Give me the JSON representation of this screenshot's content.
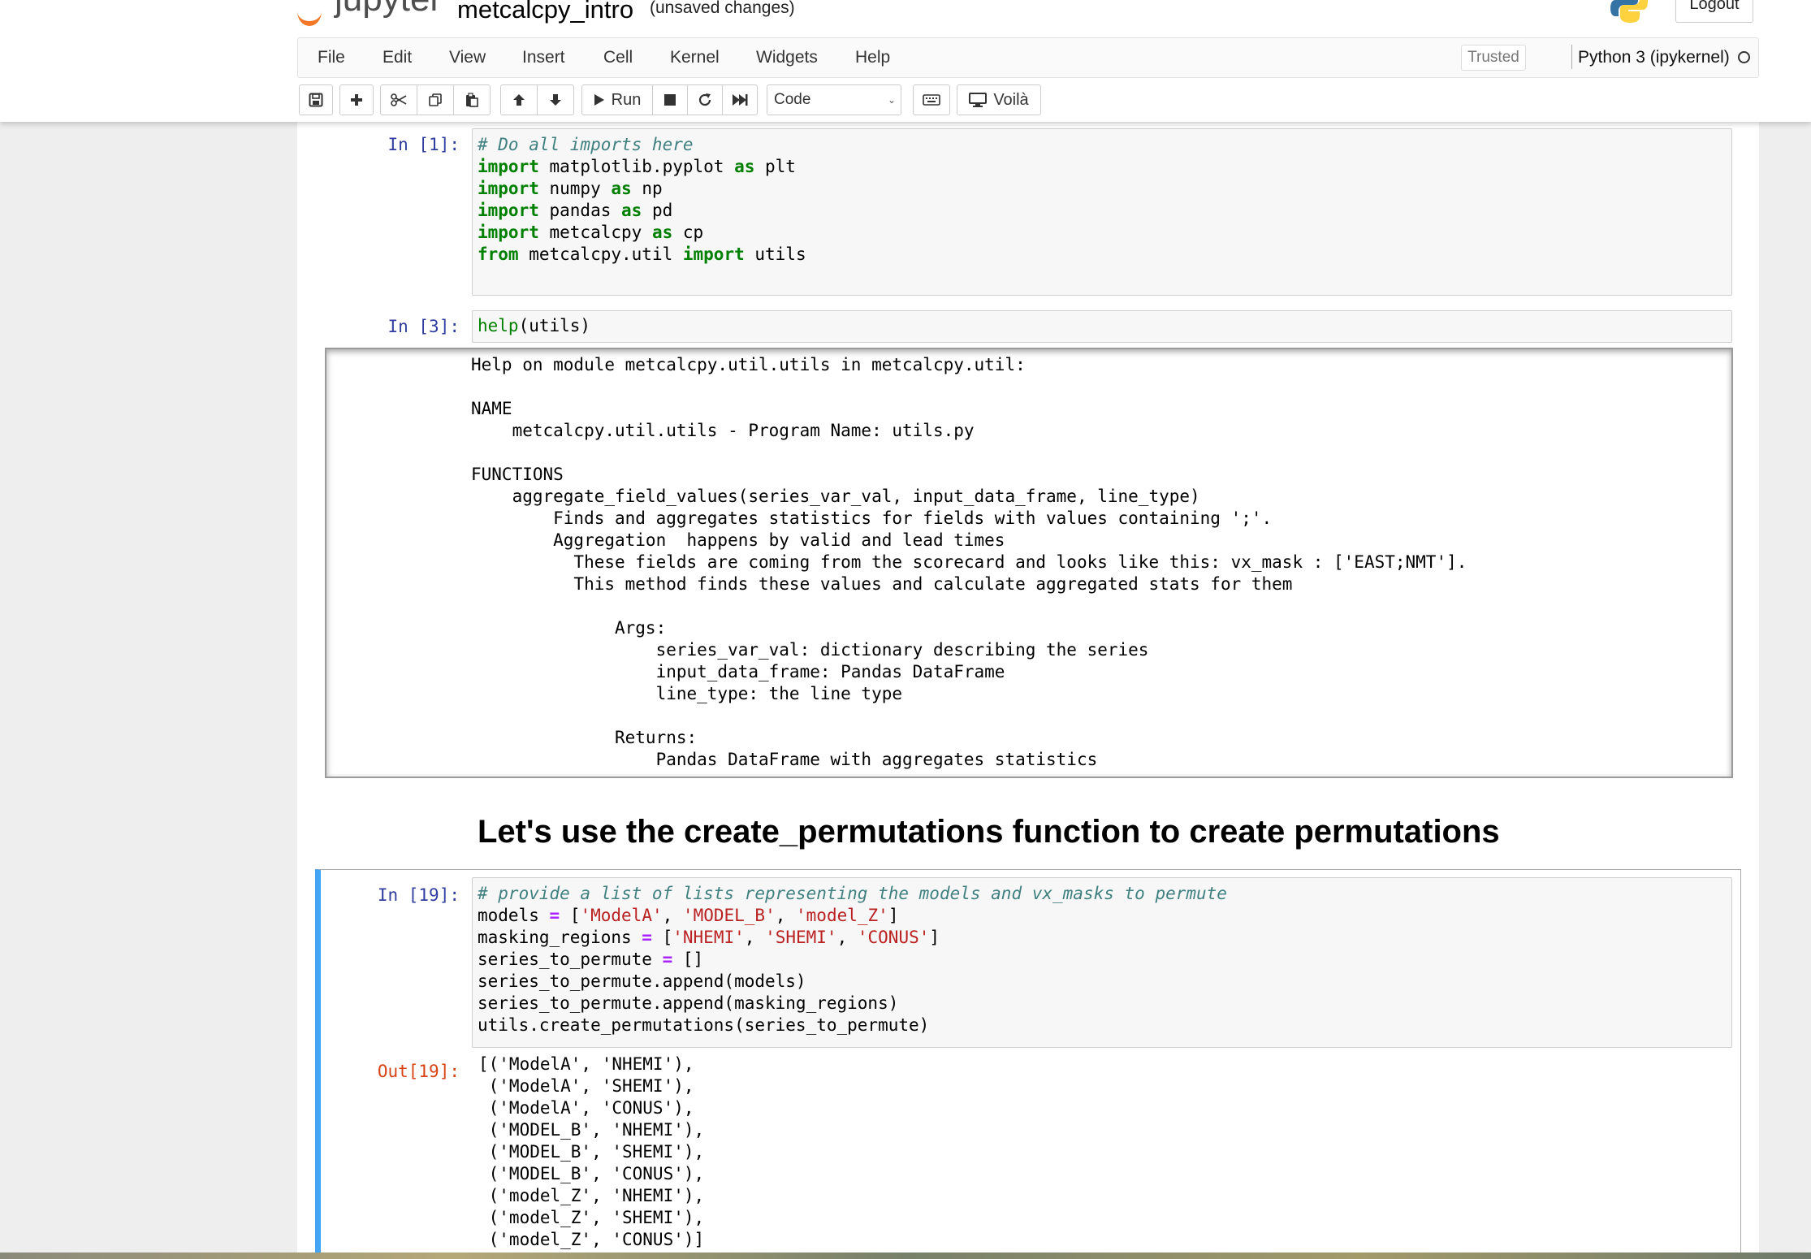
{
  "header": {
    "logo_text": "jupyter",
    "notebook_name": "metcalcpy_intro",
    "save_status": "(unsaved changes)",
    "logout_label": "Logout"
  },
  "menubar": {
    "items": [
      "File",
      "Edit",
      "View",
      "Insert",
      "Cell",
      "Kernel",
      "Widgets",
      "Help"
    ],
    "trusted_label": "Trusted",
    "kernel_name": "Python 3 (ipykernel)"
  },
  "toolbar": {
    "run_label": "Run",
    "cell_type": "Code",
    "voila_label": "Voilà"
  },
  "cells": {
    "imports": {
      "prompt": "In [1]:",
      "lines": [
        "# Do all imports here",
        "import matplotlib.pyplot as plt",
        "import numpy as np",
        "import pandas as pd",
        "import metcalcpy as cp",
        "from metcalcpy.util import utils"
      ]
    },
    "help": {
      "prompt": "In [3]:",
      "code": "help(utils)",
      "output_lines": [
        "Help on module metcalcpy.util.utils in metcalcpy.util:",
        "",
        "NAME",
        "    metcalcpy.util.utils - Program Name: utils.py",
        "",
        "FUNCTIONS",
        "    aggregate_field_values(series_var_val, input_data_frame, line_type)",
        "        Finds and aggregates statistics for fields with values containing ';'.",
        "        Aggregation  happens by valid and lead times",
        "          These fields are coming from the scorecard and looks like this: vx_mask : ['EAST;NMT'].",
        "          This method finds these values and calculate aggregated stats for them",
        "",
        "              Args:",
        "                  series_var_val: dictionary describing the series",
        "                  input_data_frame: Pandas DataFrame",
        "                  line_type: the line type",
        "",
        "              Returns:",
        "                  Pandas DataFrame with aggregates statistics"
      ]
    },
    "markdown": {
      "heading": "Let's use the create_permutations function to create permutations"
    },
    "permute": {
      "prompt": "In [19]:",
      "lines": [
        "# provide a list of lists representing the models and vx_masks to permute",
        "models = ['ModelA', 'MODEL_B', 'model_Z']",
        "masking_regions = ['NHEMI', 'SHEMI', 'CONUS']",
        "series_to_permute = []",
        "series_to_permute.append(models)",
        "series_to_permute.append(masking_regions)",
        "utils.create_permutations(series_to_permute)"
      ],
      "out_prompt": "Out[19]:",
      "output_lines": [
        "[('ModelA', 'NHEMI'),",
        " ('ModelA', 'SHEMI'),",
        " ('ModelA', 'CONUS'),",
        " ('MODEL_B', 'NHEMI'),",
        " ('MODEL_B', 'SHEMI'),",
        " ('MODEL_B', 'CONUS'),",
        " ('model_Z', 'NHEMI'),",
        " ('model_Z', 'SHEMI'),",
        " ('model_Z', 'CONUS')]"
      ]
    }
  },
  "icons": [
    "save-icon",
    "plus-icon",
    "cut-icon",
    "copy-icon",
    "paste-icon",
    "arrow-up-icon",
    "arrow-down-icon",
    "play-icon",
    "stop-icon",
    "restart-icon",
    "fast-forward-icon",
    "keyboard-icon",
    "monitor-icon",
    "python-logo-icon"
  ],
  "colors": {
    "selected_cell_accent": "#42a5f5",
    "prompt_in": "#303f9f",
    "prompt_out": "#d84315",
    "jupyter_orange": "#f37726"
  }
}
